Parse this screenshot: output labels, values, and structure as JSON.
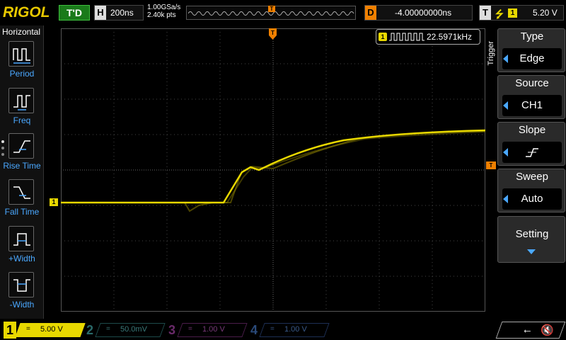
{
  "brand": "RIGOL",
  "run_status": "T'D",
  "timebase": {
    "tag": "H",
    "value": "200ns"
  },
  "acquisition": {
    "sample_rate": "1.00GSa/s",
    "points": "2.40k pts"
  },
  "memory_trigger_tag": "T",
  "delay": {
    "tag": "D",
    "value": "-4.00000000ns"
  },
  "trigger": {
    "tag": "T",
    "edge_symbol": "⭍",
    "source": "1",
    "level": "5.20 V"
  },
  "left_menu": {
    "title": "Horizontal",
    "items": [
      {
        "label": "Period",
        "icon": "period-icon"
      },
      {
        "label": "Freq",
        "icon": "freq-icon"
      },
      {
        "label": "Rise Time",
        "icon": "rise-time-icon"
      },
      {
        "label": "Fall Time",
        "icon": "fall-time-icon"
      },
      {
        "label": "+Width",
        "icon": "pos-width-icon"
      },
      {
        "label": "-Width",
        "icon": "neg-width-icon"
      }
    ]
  },
  "measurement": {
    "channel": "1",
    "value": "22.5971kHz"
  },
  "markers": {
    "ch1": "1",
    "trigger_top": "T",
    "trigger_level": "T"
  },
  "right_menu": {
    "section_label": "Trigger",
    "items": [
      {
        "title": "Type",
        "value": "Edge"
      },
      {
        "title": "Source",
        "value": "CH1"
      },
      {
        "title": "Slope",
        "value": ""
      },
      {
        "title": "Sweep",
        "value": "Auto"
      }
    ],
    "setting_label": "Setting"
  },
  "channels": [
    {
      "num": "1",
      "coupling": "=",
      "scale": "5.00 V",
      "color": "#e8d800"
    },
    {
      "num": "2",
      "coupling": "=",
      "scale": "50.0mV",
      "color": "#2a6a6a"
    },
    {
      "num": "3",
      "coupling": "=",
      "scale": "1.00 V",
      "color": "#6a2a6a"
    },
    {
      "num": "4",
      "coupling": "=",
      "scale": "1.00 V",
      "color": "#2a4a7a"
    }
  ],
  "status_icons": {
    "usb": "usb-icon",
    "speaker": "speaker-muted-icon"
  },
  "colors": {
    "trace": "#e8d800",
    "trigger": "#f08000",
    "accent": "#4aa8ff"
  }
}
